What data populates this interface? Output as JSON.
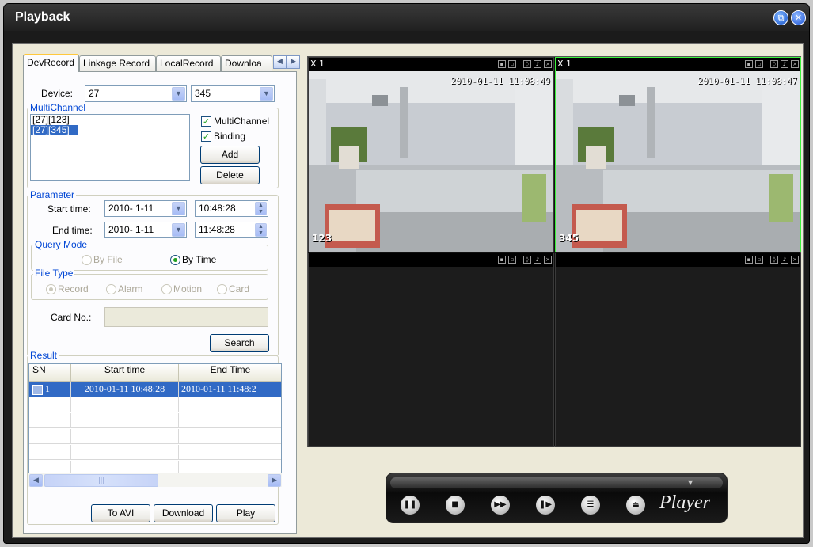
{
  "window": {
    "title": "Playback"
  },
  "tabs": [
    {
      "label": "DevRecord",
      "active": true
    },
    {
      "label": "Linkage Record",
      "active": false
    },
    {
      "label": "LocalRecord",
      "active": false
    },
    {
      "label": "Downloa",
      "active": false
    }
  ],
  "device": {
    "label": "Device:",
    "value": "27",
    "channel_value": "345"
  },
  "multichannel": {
    "group_title": "MultiChannel",
    "items": [
      {
        "label": "[27][123]",
        "selected": false
      },
      {
        "label": "[27][345]",
        "selected": true
      }
    ],
    "multichannel_label": "MultiChannel",
    "multichannel_checked": true,
    "binding_label": "Binding",
    "binding_checked": true,
    "add_label": "Add",
    "delete_label": "Delete"
  },
  "parameter": {
    "group_title": "Parameter",
    "start_label": "Start time:",
    "start_date": "2010- 1-11",
    "start_time": "10:48:28",
    "end_label": "End time:",
    "end_date": "2010- 1-11",
    "end_time": "11:48:28",
    "query_mode_title": "Query Mode",
    "by_file_label": "By File",
    "by_time_label": "By Time",
    "query_mode_selected": "By Time",
    "file_type_title": "File Type",
    "file_types": [
      "Record",
      "Alarm",
      "Motion",
      "Card"
    ],
    "file_type_selected": "Record",
    "card_label": "Card No.:",
    "card_value": ""
  },
  "search_label": "Search",
  "result": {
    "group_title": "Result",
    "headers": [
      "SN",
      "Start time",
      "End Time"
    ],
    "rows": [
      {
        "sn": "1",
        "start": "2010-01-11 10:48:28",
        "end": "2010-01-11 11:48:2",
        "selected": true
      }
    ]
  },
  "actions": {
    "to_avi": "To AVI",
    "download": "Download",
    "play": "Play"
  },
  "video_cells": [
    {
      "label": "X 1",
      "timestamp": "2010-01-11 11:08:49",
      "camera": "123",
      "active": false
    },
    {
      "label": "X 1",
      "timestamp": "2010-01-11 11:08:47",
      "camera": "345",
      "active": true
    },
    {
      "label": "",
      "timestamp": "",
      "camera": "",
      "active": false
    },
    {
      "label": "",
      "timestamp": "",
      "camera": "",
      "active": false
    }
  ],
  "player": {
    "logo": "Player",
    "buttons": [
      "pause-icon",
      "stop-icon",
      "fast-forward-icon",
      "step-forward-icon",
      "playlist-icon",
      "eject-icon"
    ]
  },
  "colors": {
    "title_bar": "#202020",
    "selection": "#316ac5",
    "active_cell_border": "#3cf23c",
    "group_title": "#0046d5"
  }
}
